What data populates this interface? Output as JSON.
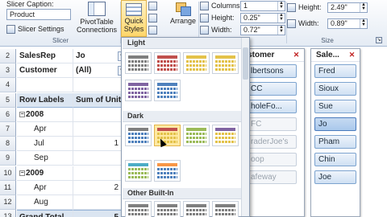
{
  "ribbon": {
    "slicer_caption_label": "Slicer Caption:",
    "slicer_caption_value": "Product",
    "slicer_settings": "Slicer Settings",
    "group_slicer": "Slicer",
    "pivot_connections": "PivotTable Connections",
    "quick_styles": "Quick Styles",
    "arrange": "Arrange",
    "columns_label": "Columns:",
    "columns_value": "1",
    "height_label": "Height:",
    "height_value": "0.25\"",
    "width_label": "Width:",
    "width_value": "0.72\"",
    "size_height_label": "Height:",
    "size_height_value": "2.49\"",
    "size_width_label": "Width:",
    "size_width_value": "0.89\"",
    "group_size": "Size"
  },
  "sheet": {
    "rows": [
      {
        "num": "2",
        "a": "SalesRep",
        "b": "Jo"
      },
      {
        "num": "3",
        "a": "Customer",
        "b": "(All)"
      },
      {
        "num": "4",
        "a": "",
        "b": ""
      },
      {
        "num": "5",
        "a": "Row Labels",
        "b": "Sum of Units"
      },
      {
        "num": "6",
        "a": "2008",
        "b": ""
      },
      {
        "num": "7",
        "a": "Apr",
        "b": ""
      },
      {
        "num": "8",
        "a": "Jul",
        "b": "1"
      },
      {
        "num": "9",
        "a": "Sep",
        "b": ""
      },
      {
        "num": "10",
        "a": "2009",
        "b": ""
      },
      {
        "num": "11",
        "a": "Apr",
        "b": "2"
      },
      {
        "num": "12",
        "a": "Aug",
        "b": ""
      },
      {
        "num": "13",
        "a": "Grand Total",
        "b": "5"
      }
    ]
  },
  "customer_slicer": {
    "title": "ustomer",
    "items": [
      "lbertsons",
      "CC",
      "holeFo...",
      "FC",
      "raderJoe's",
      "oop",
      "afeway"
    ]
  },
  "salesrep_slicer": {
    "title": "Sale...",
    "items": [
      "Fred",
      "Sioux",
      "Sue",
      "Jo",
      "Pham",
      "Chin",
      "Joe"
    ],
    "selected": "Jo"
  },
  "gallery": {
    "section_light": "Light",
    "section_dark": "Dark",
    "section_other": "Other Built-In"
  },
  "colors": {
    "blue": "#4f81bd",
    "red": "#c0504d",
    "green": "#9bbb59",
    "purple": "#8064a2",
    "aqua": "#4bacc6",
    "orange": "#f79646",
    "gray": "#7f7f7f",
    "yellow": "#e3c24a"
  }
}
